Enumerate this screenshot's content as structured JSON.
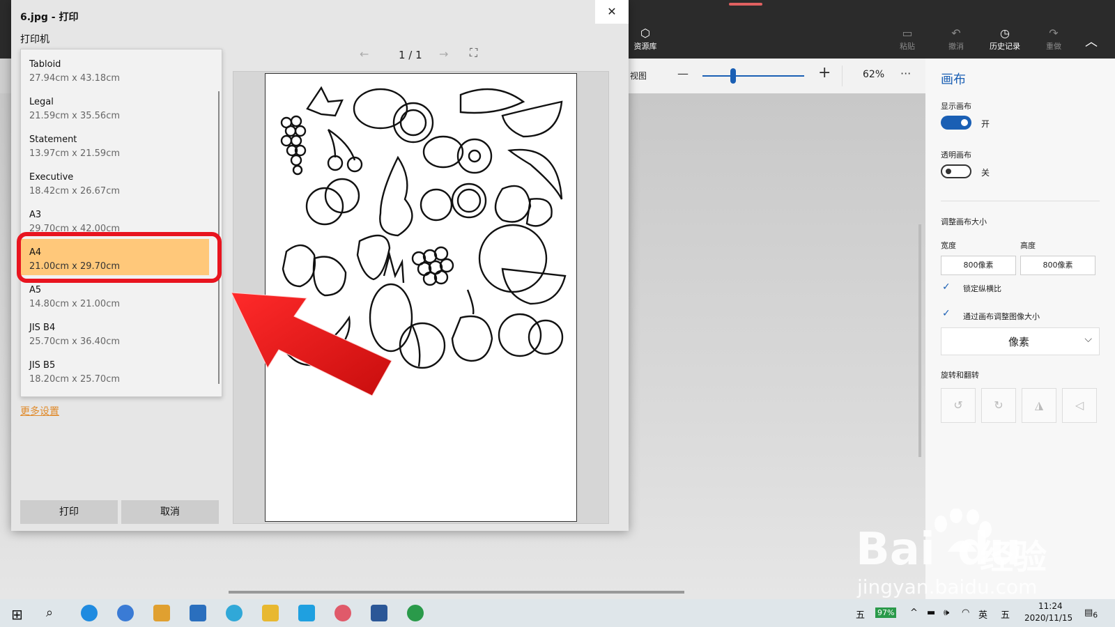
{
  "window": {
    "title": "6.jpg - 打印",
    "close_glyph": "✕"
  },
  "printer_label": "打印机",
  "paper_sizes": [
    {
      "name": "Tabloid",
      "dims": "27.94cm x 43.18cm"
    },
    {
      "name": "Legal",
      "dims": "21.59cm x 35.56cm"
    },
    {
      "name": "Statement",
      "dims": "13.97cm x 21.59cm"
    },
    {
      "name": "Executive",
      "dims": "18.42cm x 26.67cm"
    },
    {
      "name": "A3",
      "dims": "29.70cm x 42.00cm"
    },
    {
      "name": "A4",
      "dims": "21.00cm x 29.70cm",
      "selected": true
    },
    {
      "name": "A5",
      "dims": "14.80cm x 21.00cm"
    },
    {
      "name": "JIS B4",
      "dims": "25.70cm x 36.40cm"
    },
    {
      "name": "JIS B5",
      "dims": "18.20cm x 25.70cm"
    }
  ],
  "more_settings": "更多设置",
  "buttons": {
    "print": "打印",
    "cancel": "取消"
  },
  "preview_nav": {
    "prev": "←",
    "page": "1 / 1",
    "next": "→",
    "fit": "⛶"
  },
  "toolbar": {
    "library": "资源库",
    "paste": "粘贴",
    "undo": "撤消",
    "history": "历史记录",
    "redo": "重做",
    "collapse": "︿"
  },
  "viewbar": {
    "view": "视图",
    "minus": "—",
    "plus": "+",
    "zoom": "62%",
    "zoom_level": 0.3,
    "more": "···"
  },
  "canvas_panel": {
    "title": "画布",
    "show_canvas": "显示画布",
    "show_state": "开",
    "transparent_canvas": "透明画布",
    "transparent_state": "关",
    "resize": "调整画布大小",
    "width_label": "宽度",
    "height_label": "高度",
    "width": "800像素",
    "height": "800像素",
    "lock_aspect": "锁定纵横比",
    "resize_image": "通过画布调整图像大小",
    "unit": "像素",
    "rotate_flip": "旋转和翻转"
  },
  "taskbar": {
    "ime1": "五",
    "battery": "97%",
    "lang": "英",
    "ime2": "五",
    "time": "11:24",
    "date": "2020/11/15",
    "notif_count": "6"
  },
  "watermark": {
    "brand": "Bai",
    "brand2": "du",
    "cn": "经验",
    "url": "jingyan.baidu.com"
  },
  "colors": {
    "accent": "#1a5fb4",
    "selected": "#ffc87a",
    "highlight": "#e8141f",
    "arrow": "#e01a1a"
  }
}
